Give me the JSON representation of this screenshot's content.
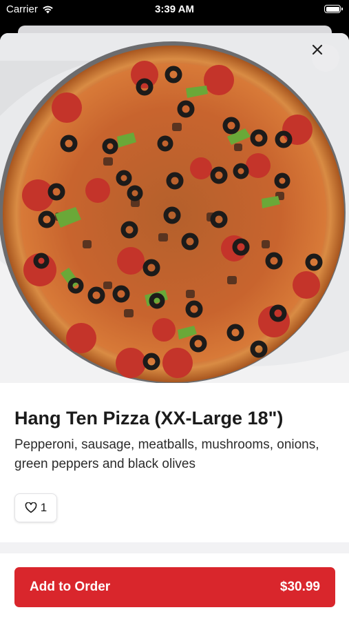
{
  "status_bar": {
    "carrier": "Carrier",
    "time": "3:39 AM"
  },
  "item": {
    "name": "Hang Ten Pizza (XX-Large 18\")",
    "description": "Pepperoni, sausage, meatballs, mushrooms, onions, green peppers and black olives",
    "like_count": "1"
  },
  "footer": {
    "add_label": "Add to Order",
    "price": "$30.99"
  },
  "colors": {
    "accent": "#d9262c",
    "background": "#ffffff"
  },
  "icons": {
    "close": "close-icon",
    "like": "heart-icon",
    "wifi": "wifi-icon",
    "battery": "battery-icon"
  }
}
